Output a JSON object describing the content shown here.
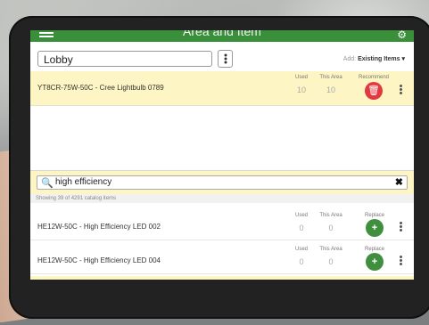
{
  "header": {
    "title": "Area and Item",
    "menu_icon": "hamburger-menu-icon",
    "settings_icon": "gear-icon"
  },
  "area": {
    "value": "Lobby",
    "add_prefix": "Add:",
    "add_value": "Existing Items ▾"
  },
  "existing_item": {
    "name": "YT8CR-75W-50C - Cree Lightbulb 0789",
    "col_used": "Used",
    "col_this_area": "This Area",
    "col_action": "Recommend",
    "used": "10",
    "this_area": "10",
    "action_icon": "trash-icon"
  },
  "search": {
    "query": "high efficiency",
    "search_icon": "search-icon",
    "clear_icon": "close-icon"
  },
  "results_summary": "Showing 39 of 4291 catalog items",
  "results": [
    {
      "name": "HE12W-50C - High Efficiency LED 002",
      "col_used": "Used",
      "col_this_area": "This Area",
      "col_action": "Replace",
      "used": "0",
      "this_area": "0",
      "action_icon": "plus-icon"
    },
    {
      "name": "HE12W-50C - High Efficiency LED 004",
      "col_used": "Used",
      "col_this_area": "This Area",
      "col_action": "Replace",
      "used": "0",
      "this_area": "0",
      "action_icon": "plus-icon"
    }
  ],
  "colors": {
    "header_green": "#3a8f3a",
    "highlight_yellow": "#fdf6c4",
    "delete_red": "#e2383f",
    "add_green": "#3f8f3f"
  }
}
